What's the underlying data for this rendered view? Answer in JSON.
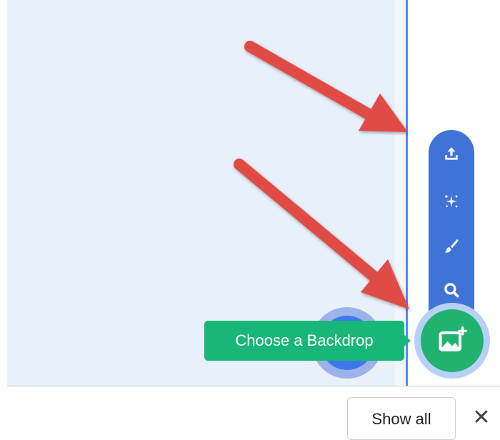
{
  "tooltip": {
    "label": "Choose a Backdrop"
  },
  "backdrop_menu": {
    "items": [
      {
        "icon": "upload-icon"
      },
      {
        "icon": "surprise-icon"
      },
      {
        "icon": "paint-icon"
      },
      {
        "icon": "search-icon"
      }
    ],
    "main_icon": "backdrop-image-icon"
  },
  "download_bar": {
    "show_all_label": "Show all",
    "close_label": "✕"
  },
  "colors": {
    "menu_blue": "#3f74d6",
    "backdrop_green": "#1fb36f",
    "annotation_red": "#e14b44",
    "stage_bg": "#e8f0fb"
  }
}
